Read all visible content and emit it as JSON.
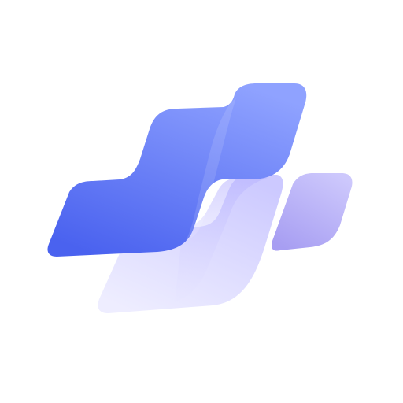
{
  "logo": {
    "icon": "abstract-ribbon-logo-icon",
    "colors": {
      "background": "#ffffff",
      "front_ribbon_top": "#8fa2ff",
      "front_ribbon_bottom": "#4a62ef",
      "back_ribbon_top": "#c9c6ff",
      "back_ribbon_bottom": "#e9e8ff",
      "side_tab_top": "#c7c1fb",
      "side_tab_bottom": "#a9a0f3"
    }
  }
}
